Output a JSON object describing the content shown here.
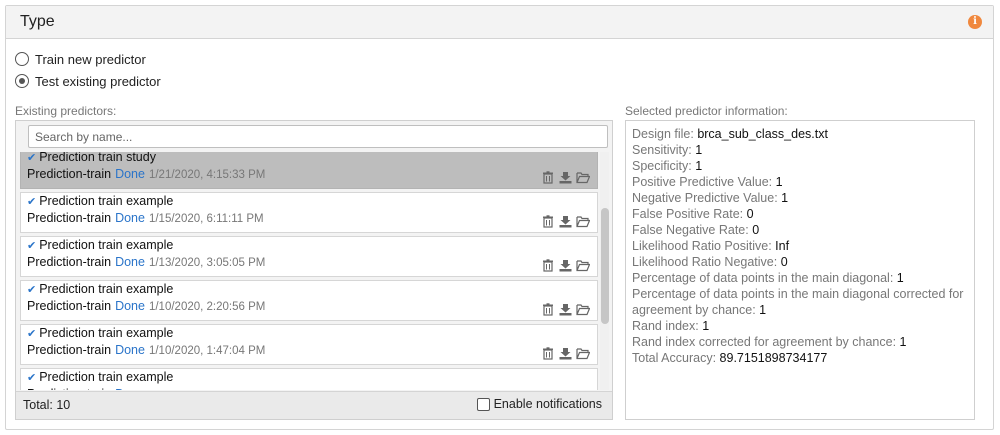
{
  "panel": {
    "title": "Type"
  },
  "options": [
    {
      "label": "Train new predictor",
      "checked": false
    },
    {
      "label": "Test existing predictor",
      "checked": true
    }
  ],
  "existing_label": "Existing predictors:",
  "selected_label": "Selected predictor information:",
  "search": {
    "placeholder": "Search by name...",
    "value": ""
  },
  "predictors": [
    {
      "name": "Prediction train study",
      "type": "Prediction-train",
      "status": "Done",
      "date": "1/21/2020, 4:15:33 PM",
      "selected": true
    },
    {
      "name": "Prediction train example",
      "type": "Prediction-train",
      "status": "Done",
      "date": "1/15/2020, 6:11:11 PM",
      "selected": false
    },
    {
      "name": "Prediction train example",
      "type": "Prediction-train",
      "status": "Done",
      "date": "1/13/2020, 3:05:05 PM",
      "selected": false
    },
    {
      "name": "Prediction train example",
      "type": "Prediction-train",
      "status": "Done",
      "date": "1/10/2020, 2:20:56 PM",
      "selected": false
    },
    {
      "name": "Prediction train example",
      "type": "Prediction-train",
      "status": "Done",
      "date": "1/10/2020, 1:47:04 PM",
      "selected": false
    },
    {
      "name": "Prediction train example",
      "type": "Prediction-train",
      "status": "Done",
      "date": "",
      "selected": false
    }
  ],
  "footer": {
    "total": "Total: 10",
    "notifications_label": "Enable notifications",
    "notifications_checked": false
  },
  "info": [
    {
      "label": "Design file: ",
      "value": "brca_sub_class_des.txt"
    },
    {
      "label": "Sensitivity: ",
      "value": "1"
    },
    {
      "label": "Specificity: ",
      "value": "1"
    },
    {
      "label": "Positive Predictive Value: ",
      "value": "1"
    },
    {
      "label": "Negative Predictive Value: ",
      "value": "1"
    },
    {
      "label": "False Positive Rate: ",
      "value": "0"
    },
    {
      "label": "False Negative Rate: ",
      "value": "0"
    },
    {
      "label": "Likelihood Ratio Positive: ",
      "value": "Inf"
    },
    {
      "label": "Likelihood Ratio Negative: ",
      "value": "0"
    },
    {
      "label": "Percentage of data points in the main diagonal: ",
      "value": "1"
    },
    {
      "label": "Percentage of data points in the main diagonal corrected for agreement by chance: ",
      "value": "1"
    },
    {
      "label": "Rand index: ",
      "value": "1"
    },
    {
      "label": "Rand index corrected for agreement by chance: ",
      "value": "1"
    },
    {
      "label": "Total Accuracy: ",
      "value": "89.7151898734177"
    }
  ],
  "icons": {
    "info": "info-icon",
    "check": "checkmark-icon",
    "delete": "trash-icon",
    "download": "download-icon",
    "open": "folder-open-icon"
  },
  "colors": {
    "accent": "#2a74c9",
    "info_icon": "#f0883e",
    "selected_row": "#bdbdbd"
  }
}
